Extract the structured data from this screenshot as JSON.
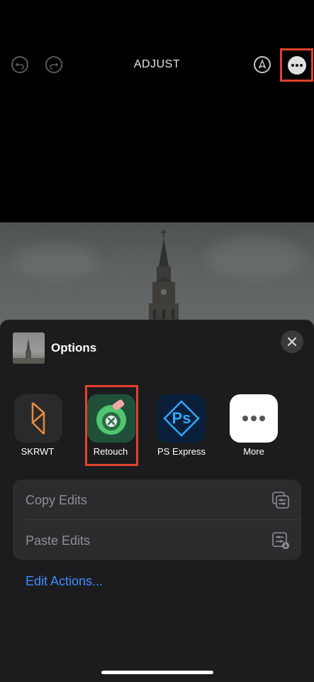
{
  "header": {
    "title": "ADJUST",
    "icons": [
      "undo-icon",
      "redo-icon",
      "markup-icon",
      "more-icon"
    ]
  },
  "sheet": {
    "title": "Options",
    "apps": [
      {
        "label": "SKRWT",
        "icon": "skrwt-app-icon"
      },
      {
        "label": "Retouch",
        "icon": "retouch-app-icon"
      },
      {
        "label": "PS Express",
        "icon": "ps-express-app-icon"
      },
      {
        "label": "More",
        "icon": "more-apps-icon"
      }
    ],
    "actions": [
      {
        "label": "Copy Edits",
        "icon": "copy-edits-icon"
      },
      {
        "label": "Paste Edits",
        "icon": "paste-edits-icon"
      }
    ],
    "edit_actions_label": "Edit Actions...",
    "ps_logo_text": "Ps"
  },
  "colors": {
    "highlight": "#e2422e",
    "link": "#3d8bff",
    "sheet_bg": "#1c1c1e"
  }
}
